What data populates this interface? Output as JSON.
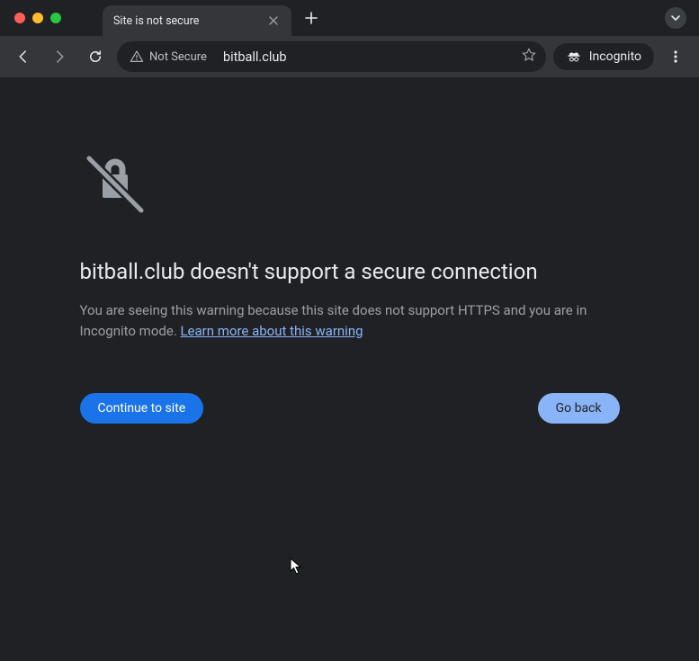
{
  "tab": {
    "title": "Site is not secure"
  },
  "toolbar": {
    "security_chip": "Not Secure",
    "url": "bitball.club",
    "incognito_label": "Incognito"
  },
  "page": {
    "heading": "bitball.club doesn't support a secure connection",
    "body_text": "You are seeing this warning because this site does not support HTTPS and you are in Incognito mode. ",
    "learn_more": "Learn more about this warning",
    "continue_label": "Continue to site",
    "goback_label": "Go back"
  }
}
